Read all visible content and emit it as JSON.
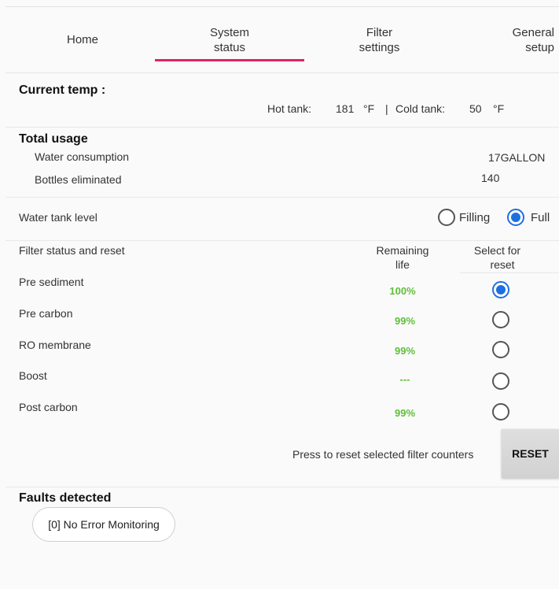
{
  "tabs": [
    {
      "line1": "Home",
      "line2": ""
    },
    {
      "line1": "System",
      "line2": "status"
    },
    {
      "line1": "Filter",
      "line2": "settings"
    },
    {
      "line1": "General",
      "line2": "setup"
    }
  ],
  "current_temp": {
    "title": "Current temp :",
    "hot_label": "Hot tank:",
    "hot_value": "181",
    "hot_unit": "°F",
    "separator": "|",
    "cold_label": "Cold tank:",
    "cold_value": "50",
    "cold_unit": "°F"
  },
  "total_usage": {
    "title": "Total usage",
    "water_label": "Water consumption",
    "water_value": "17GALLON",
    "bottles_label": "Bottles eliminated",
    "bottles_value": "140"
  },
  "tank_level": {
    "label": "Water tank level",
    "option_filling": "Filling",
    "option_full": "Full",
    "selected": "Full"
  },
  "filters": {
    "title": "Filter status and reset",
    "col_remaining_1": "Remaining",
    "col_remaining_2": "life",
    "col_select_1": "Select for",
    "col_select_2": "reset",
    "rows": [
      {
        "name": "Pre sediment",
        "life": "100%",
        "selected": true
      },
      {
        "name": "Pre carbon",
        "life": "99%",
        "selected": false
      },
      {
        "name": "RO membrane",
        "life": "99%",
        "selected": false
      },
      {
        "name": "Boost",
        "life": "---",
        "selected": false
      },
      {
        "name": "Post carbon",
        "life": "99%",
        "selected": false
      }
    ],
    "reset_hint": "Press to reset selected filter counters",
    "reset_label": "RESET"
  },
  "faults": {
    "title": "Faults detected",
    "status": "[0] No Error Monitoring"
  },
  "colors": {
    "accent": "#e0245e",
    "radio_active": "#1d6fe0",
    "life_good": "#5fbf3a"
  }
}
